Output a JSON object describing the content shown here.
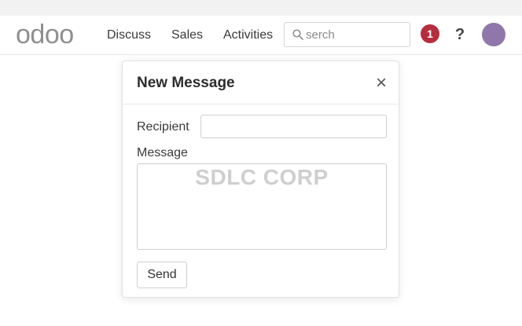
{
  "navbar": {
    "logo": "odoo",
    "menu": [
      {
        "label": "Discuss"
      },
      {
        "label": "Sales"
      },
      {
        "label": "Activities"
      }
    ],
    "search": {
      "placeholder": "serch",
      "value": ""
    },
    "notification_count": "1",
    "help_label": "?"
  },
  "modal": {
    "title": "New Message",
    "close_label": "×",
    "recipient_label": "Recipient",
    "recipient_value": "",
    "message_label": "Message",
    "message_value": "",
    "watermark": "SDLC CORP",
    "send_label": "Send"
  },
  "colors": {
    "badge": "#b62d3d",
    "avatar": "#8f77ab",
    "logo": "#8f8f8f"
  },
  "icons": {
    "search": "search-icon",
    "help": "help-icon",
    "close": "close-icon"
  }
}
